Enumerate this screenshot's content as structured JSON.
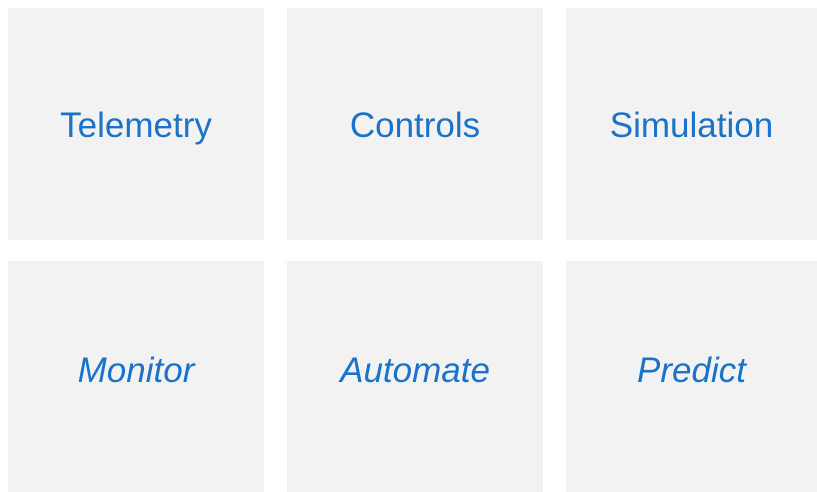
{
  "tiles": [
    {
      "label": "Telemetry"
    },
    {
      "label": "Controls"
    },
    {
      "label": "Simulation"
    },
    {
      "label": "Monitor"
    },
    {
      "label": "Automate"
    },
    {
      "label": "Predict"
    }
  ],
  "colors": {
    "tile_background": "#f2f2f2",
    "label_text": "#1a73c8",
    "page_background": "#ffffff"
  }
}
